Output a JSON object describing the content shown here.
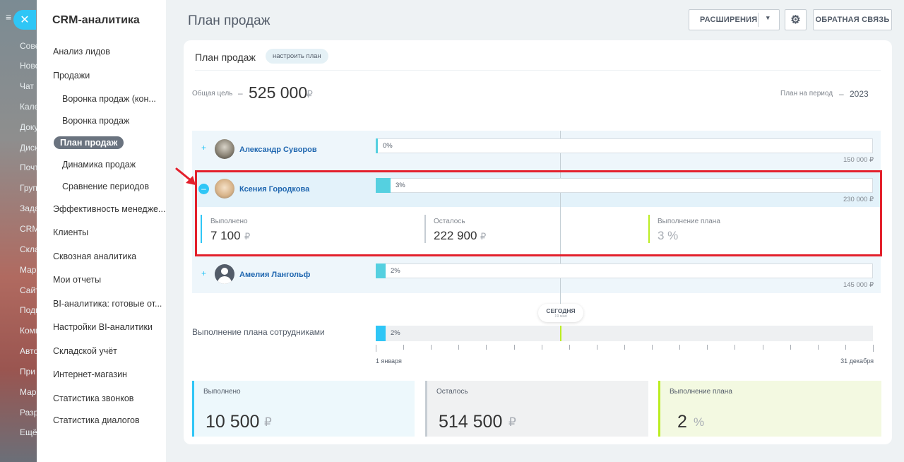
{
  "background_menu": {
    "items": [
      "Сове",
      "Ново",
      "Чат и",
      "Кале",
      "Доку",
      "Диск",
      "Почт",
      "Груп",
      "Зада",
      "CRM",
      "Скла",
      "Мар",
      "Сайт",
      "Подп",
      "Комп",
      "Авто",
      "При",
      "Мар",
      "Разр",
      "Ещё"
    ]
  },
  "sidebar": {
    "title": "CRM-аналитика",
    "items": [
      {
        "label": "Анализ лидов"
      },
      {
        "label": "Продажи"
      },
      {
        "label": "Воронка продаж (кон..."
      },
      {
        "label": "Воронка продаж"
      },
      {
        "label": "План продаж"
      },
      {
        "label": "Динамика продаж"
      },
      {
        "label": "Сравнение периодов"
      },
      {
        "label": "Эффективность менедже..."
      },
      {
        "label": "Клиенты"
      },
      {
        "label": "Сквозная аналитика"
      },
      {
        "label": "Мои отчеты"
      },
      {
        "label": "BI-аналитика: готовые от..."
      },
      {
        "label": "Настройки BI-аналитики"
      },
      {
        "label": "Складской учёт"
      },
      {
        "label": "Интернет-магазин"
      },
      {
        "label": "Статистика звонков"
      },
      {
        "label": "Статистика диалогов"
      }
    ]
  },
  "header": {
    "title": "План продаж",
    "extensions_label": "РАСШИРЕНИЯ",
    "feedback_label": "ОБРАТНАЯ СВЯЗЬ"
  },
  "plan": {
    "title": "План продаж",
    "configure_label": "настроить план",
    "goal_label": "Общая цель",
    "goal_dash": "–",
    "goal_value": "525 000",
    "currency": "₽",
    "period_label": "План на период",
    "period_dash": "–",
    "period_value": "2023",
    "today_label": "СЕГОДНЯ",
    "today_date": "19 мая",
    "employees": [
      {
        "name": "Александр Суворов",
        "percent": "0%",
        "progress": 0.0,
        "target": "150 000 ₽",
        "expanded": false
      },
      {
        "name": "Ксения Городкова",
        "percent": "3%",
        "progress": 0.03,
        "target": "230 000 ₽",
        "expanded": true
      },
      {
        "name": "Амелия Лангольф",
        "percent": "2%",
        "progress": 0.02,
        "target": "145 000 ₽",
        "expanded": false
      }
    ],
    "details": {
      "done_label": "Выполнено",
      "done_value": "7 100",
      "left_label": "Осталось",
      "left_value": "222 900",
      "plan_label": "Выполнение плана",
      "plan_value": "3 %"
    },
    "team": {
      "label": "Выполнение плана сотрудниками",
      "percent": "2%",
      "progress": 0.02,
      "start_label": "1 января",
      "end_label": "31 декабря"
    },
    "summary": {
      "done_label": "Выполнено",
      "done_value": "10 500",
      "left_label": "Осталось",
      "left_value": "514 500",
      "plan_label": "Выполнение плана",
      "plan_value": "2",
      "plan_unit": "%"
    }
  },
  "colors": {
    "accent": "#2fc6f6",
    "highlight": "#e3202c",
    "progress": "#55d0e0",
    "plan_green": "#bbed21"
  }
}
